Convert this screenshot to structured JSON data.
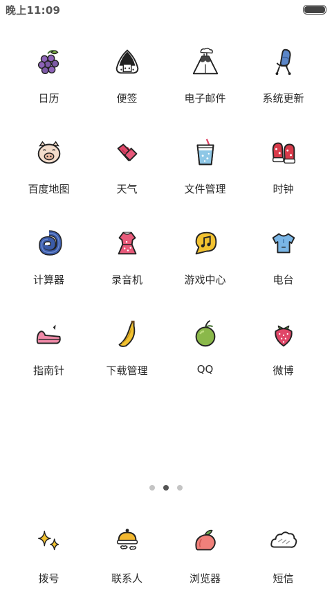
{
  "status_bar": {
    "time": "晚上11:09",
    "battery_level": 1.0,
    "battery_icon": "battery-icon"
  },
  "apps": [
    {
      "label": "日历",
      "icon": "grapes-icon",
      "color": "#7d5aa6"
    },
    {
      "label": "便签",
      "icon": "onigiri-icon",
      "color": "#222222"
    },
    {
      "label": "电子邮件",
      "icon": "volcano-icon",
      "color": "#444444"
    },
    {
      "label": "系统更新",
      "icon": "chair-icon",
      "color": "#5b86c8"
    },
    {
      "label": "百度地图",
      "icon": "pig-icon",
      "color": "#f0d6c2"
    },
    {
      "label": "天气",
      "icon": "candy-icon",
      "color": "#e04668"
    },
    {
      "label": "文件管理",
      "icon": "drink-cup-icon",
      "color": "#8ec7e6"
    },
    {
      "label": "时钟",
      "icon": "mittens-icon",
      "color": "#d83a4a"
    },
    {
      "label": "计算器",
      "icon": "shell-icon",
      "color": "#3b5ba8"
    },
    {
      "label": "录音机",
      "icon": "dress-icon",
      "color": "#e85a7a"
    },
    {
      "label": "游戏中心",
      "icon": "music-bubble-icon",
      "color": "#f2c230"
    },
    {
      "label": "电台",
      "icon": "tshirt-icon",
      "color": "#7ab6e6"
    },
    {
      "label": "指南针",
      "icon": "slipper-icon",
      "color": "#f08aa8"
    },
    {
      "label": "下载管理",
      "icon": "banana-icon",
      "color": "#f2c230"
    },
    {
      "label": "QQ",
      "icon": "apple-icon",
      "color": "#8ab84a"
    },
    {
      "label": "微博",
      "icon": "strawberry-icon",
      "color": "#e04668"
    }
  ],
  "page_indicator": {
    "count": 3,
    "active_index": 1
  },
  "dock": [
    {
      "label": "拨号",
      "icon": "sparkle-icon",
      "color": "#f2c230"
    },
    {
      "label": "联系人",
      "icon": "bell-icon",
      "color": "#f2b830"
    },
    {
      "label": "浏览器",
      "icon": "peach-icon",
      "color": "#f0807a"
    },
    {
      "label": "短信",
      "icon": "cloud-icon",
      "color": "#cccccc"
    }
  ]
}
